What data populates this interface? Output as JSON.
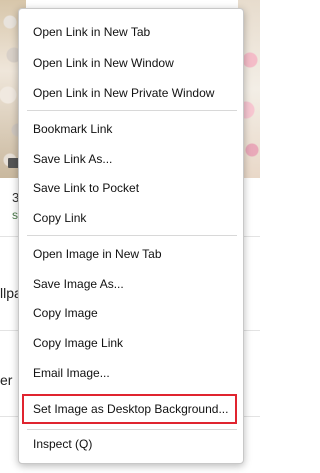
{
  "background": {
    "caption": "3",
    "sub": "sl",
    "text_1": "llpa",
    "text_2": "er"
  },
  "menu": {
    "items": [
      {
        "label": "Open Link in New Tab"
      },
      {
        "label": "Open Link in New Window"
      },
      {
        "label": "Open Link in New Private Window"
      },
      {
        "label": "Bookmark Link"
      },
      {
        "label": "Save Link As..."
      },
      {
        "label": "Save Link to Pocket"
      },
      {
        "label": "Copy Link"
      },
      {
        "label": "Open Image in New Tab"
      },
      {
        "label": "Save Image As..."
      },
      {
        "label": "Copy Image"
      },
      {
        "label": "Copy Image Link"
      },
      {
        "label": "Email Image..."
      },
      {
        "label": "Set Image as Desktop Background..."
      },
      {
        "label": "Inspect (Q)"
      }
    ]
  },
  "colors": {
    "highlight_border": "#e0242f",
    "menu_background": "#ffffff",
    "menu_border": "#c8c8c8"
  }
}
